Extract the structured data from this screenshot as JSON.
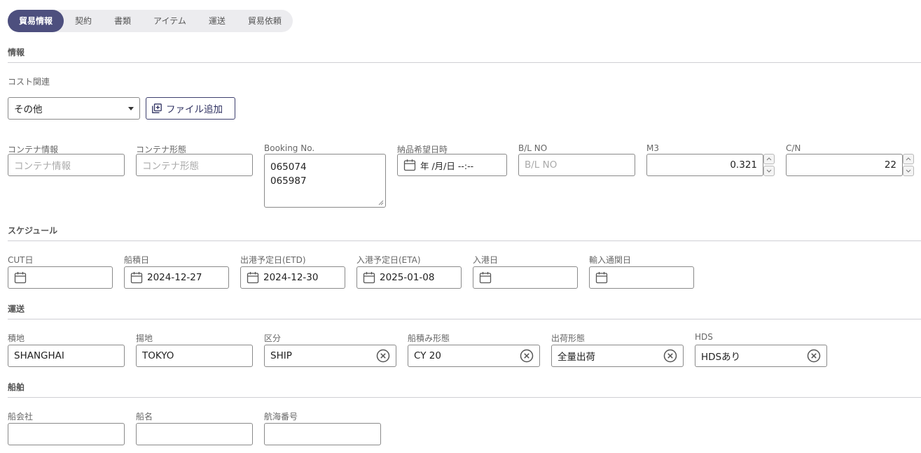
{
  "tabs": [
    {
      "label": "貿易情報",
      "active": true
    },
    {
      "label": "契約"
    },
    {
      "label": "書類"
    },
    {
      "label": "アイテム"
    },
    {
      "label": "運送"
    },
    {
      "label": "貿易依頼"
    }
  ],
  "info": {
    "title": "情報",
    "cost_label": "コスト関連",
    "cost_select": "その他",
    "file_button": "ファイル追加"
  },
  "container": {
    "info_label": "コンテナ情報",
    "info_placeholder": "コンテナ情報",
    "type_label": "コンテナ形態",
    "type_placeholder": "コンテナ形態",
    "booking_label": "Booking No.",
    "booking_lines": [
      "065074",
      "065987"
    ],
    "delivery_label": "納品希望日時",
    "delivery_value": "年 /月/日 --:--",
    "bl_label": "B/L NO",
    "bl_placeholder": "B/L NO",
    "m3_label": "M3",
    "m3_value": "0.321",
    "cn_label": "C/N",
    "cn_value": "22"
  },
  "schedule": {
    "title": "スケジュール",
    "cut_label": "CUT日",
    "cut_value": "",
    "loading_label": "船積日",
    "loading_value": "2024-12-27",
    "etd_label": "出港予定日(ETD)",
    "etd_value": "2024-12-30",
    "eta_label": "入港予定日(ETA)",
    "eta_value": "2025-01-08",
    "arrival_label": "入港日",
    "arrival_value": "",
    "customs_label": "輸入通関日",
    "customs_value": ""
  },
  "transport": {
    "title": "運送",
    "origin_label": "積地",
    "origin_value": "SHANGHAI",
    "dest_label": "揚地",
    "dest_value": "TOKYO",
    "kind_label": "区分",
    "kind_value": "SHIP",
    "loadtype_label": "船積み形態",
    "loadtype_value": "CY 20",
    "shiptype_label": "出荷形態",
    "shiptype_value": "全量出荷",
    "hds_label": "HDS",
    "hds_value": "HDSあり"
  },
  "vessel": {
    "title": "船舶",
    "company_label": "船会社",
    "company_value": "",
    "name_label": "船名",
    "name_value": "",
    "voyage_label": "航海番号",
    "voyage_value": ""
  },
  "icons": {
    "calendar": "calendar-icon",
    "clear": "clear-circle-icon",
    "file_add": "file-add-icon",
    "caret": "chevron-down-icon"
  },
  "colors": {
    "tab_active_bg": "#4d4f7e",
    "tab_bar_bg": "#ececef",
    "button_border": "#3d3f6e"
  }
}
